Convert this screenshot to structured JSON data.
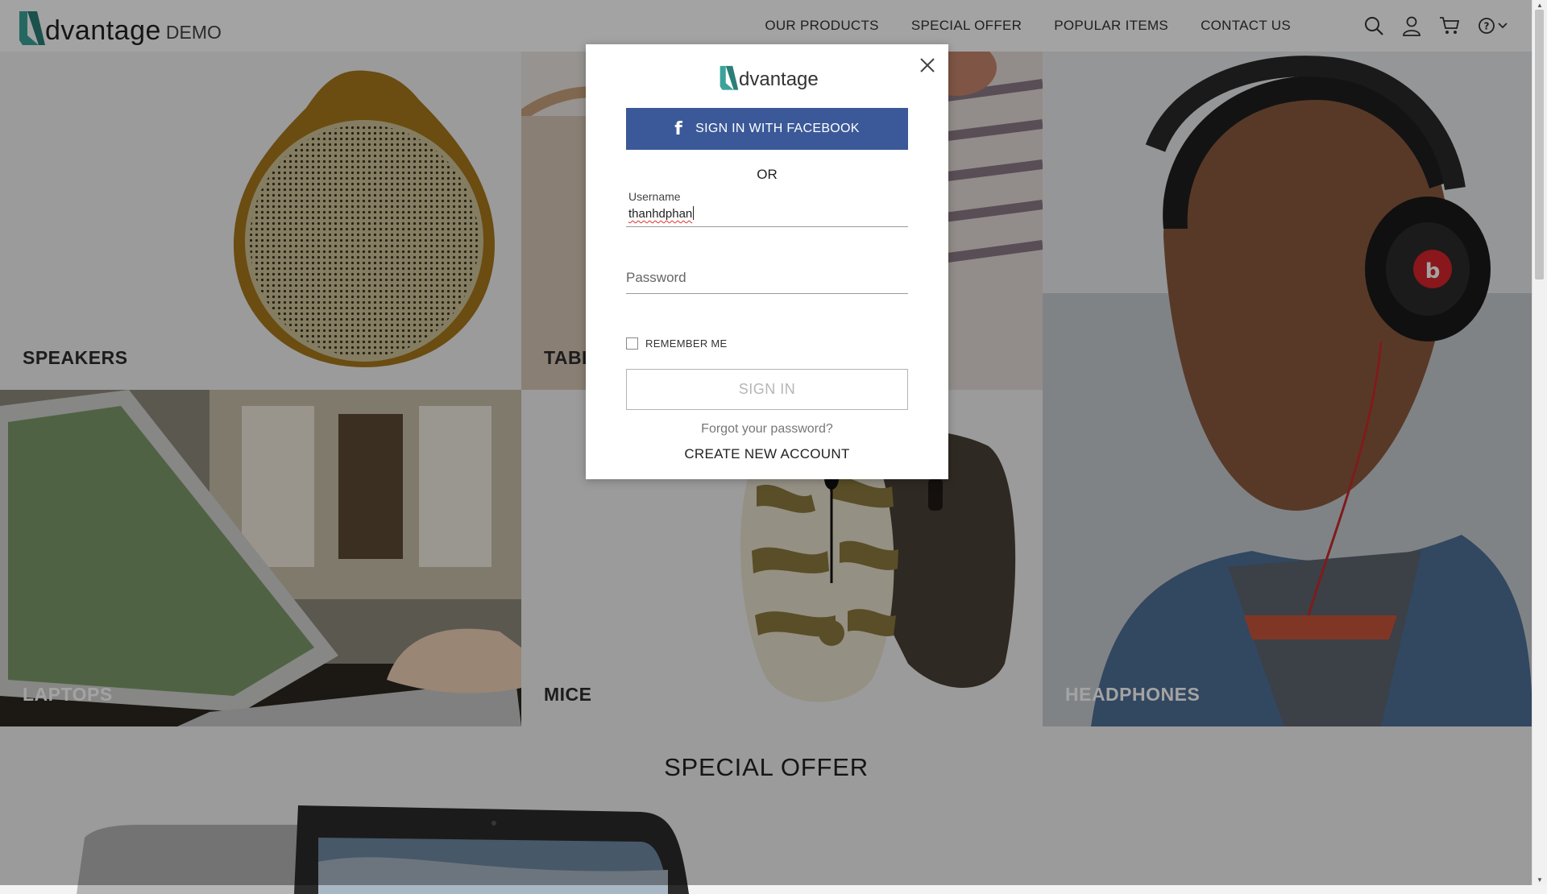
{
  "brand": {
    "logo_text": "dvantage",
    "demo_text": "DEMO"
  },
  "nav": {
    "items": [
      "OUR PRODUCTS",
      "SPECIAL OFFER",
      "POPULAR ITEMS",
      "CONTACT US"
    ],
    "icons": [
      "search-icon",
      "user-icon",
      "cart-icon",
      "help-icon",
      "chevron-down-icon"
    ]
  },
  "categories": {
    "speakers": "SPEAKERS",
    "tablets": "TABL",
    "headphones": "HEADPHONES",
    "laptops": "LAPTOPS",
    "mice": "MICE"
  },
  "modal": {
    "logo_text": "dvantage",
    "facebook_button": "SIGN IN WITH FACEBOOK",
    "or_text": "OR",
    "username_label": "Username",
    "username_value": "thanhdphan",
    "password_placeholder": "Password",
    "remember_label": "REMEMBER ME",
    "remember_checked": false,
    "signin_button": "SIGN IN",
    "forgot_link": "Forgot your password?",
    "create_link": "CREATE NEW ACCOUNT"
  },
  "special_offer": {
    "title": "SPECIAL OFFER"
  },
  "colors": {
    "brand_teal": "#3aa39a",
    "facebook_blue": "#3b5998"
  }
}
